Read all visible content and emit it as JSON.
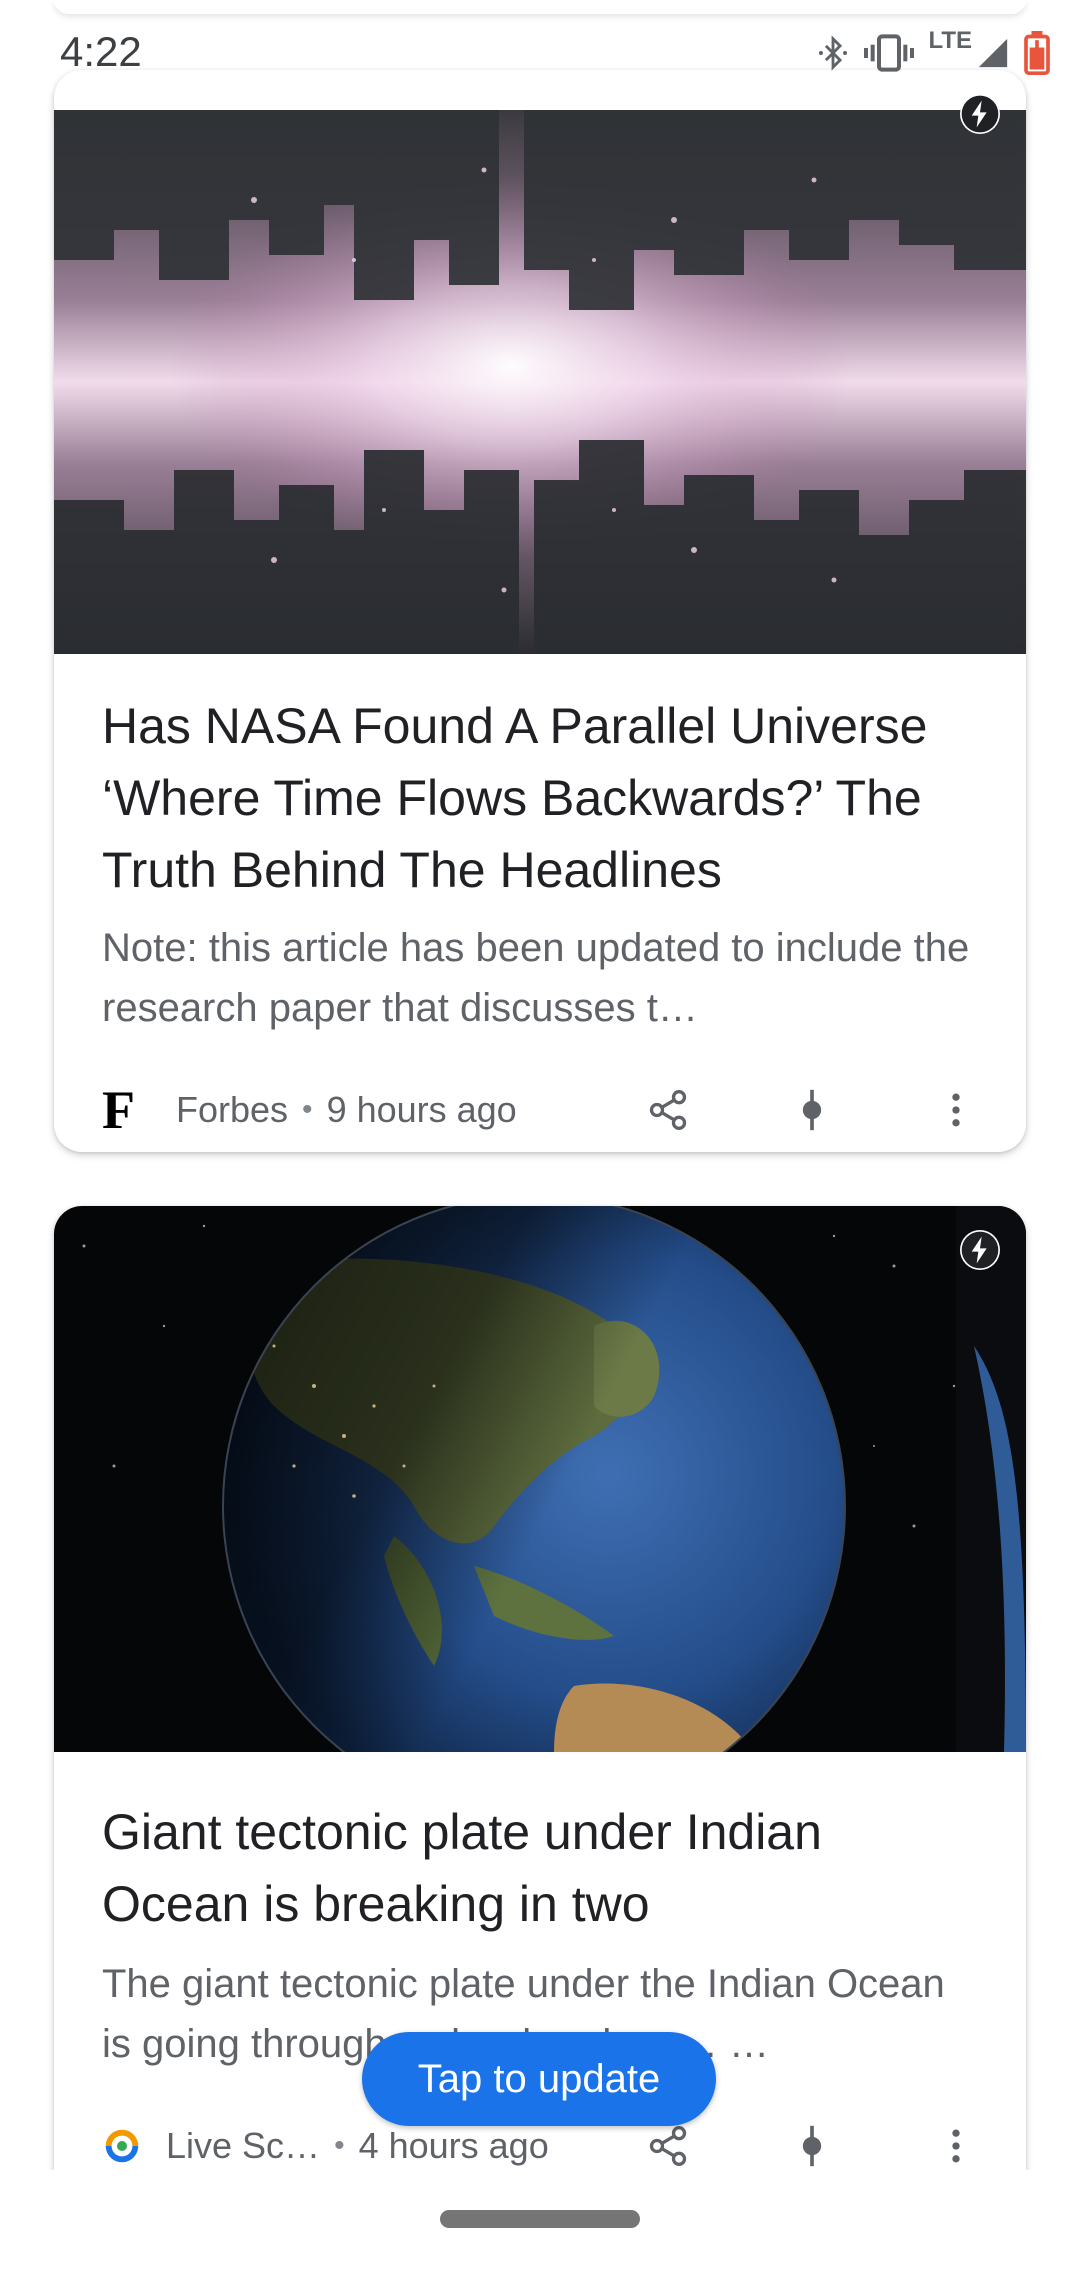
{
  "status_bar": {
    "time": "4:22",
    "network": "LTE"
  },
  "cards": [
    {
      "title": "Has NASA Found A Parallel Universe ‘Where Time Flows Backwards?’ The Truth Behind The Headlines",
      "snippet": "Note: this article has been updated to include the research paper that discusses t…",
      "source": "Forbes",
      "source_logo": "F",
      "age": "9 hours ago",
      "image": "mirrored-city-skyline"
    },
    {
      "title": "Giant tectonic plate under Indian Ocean is breaking in two",
      "snippet": "The giant tectonic plate under the Indian Ocean is going through a slow breakup … …",
      "source": "Live Sc…",
      "age": "4 hours ago",
      "image": "earth-from-space-asia"
    }
  ],
  "footer_separator": "•",
  "update_pill": {
    "label": "Tap to update"
  },
  "icons": {
    "amp": "lightning-bolt-icon",
    "share": "share-icon",
    "coverage": "full-coverage-icon",
    "more": "more-vert-icon"
  },
  "colors": {
    "accent": "#1a73e8",
    "title": "#202124",
    "secondary": "#5f6368",
    "battery": "#e8553c"
  }
}
